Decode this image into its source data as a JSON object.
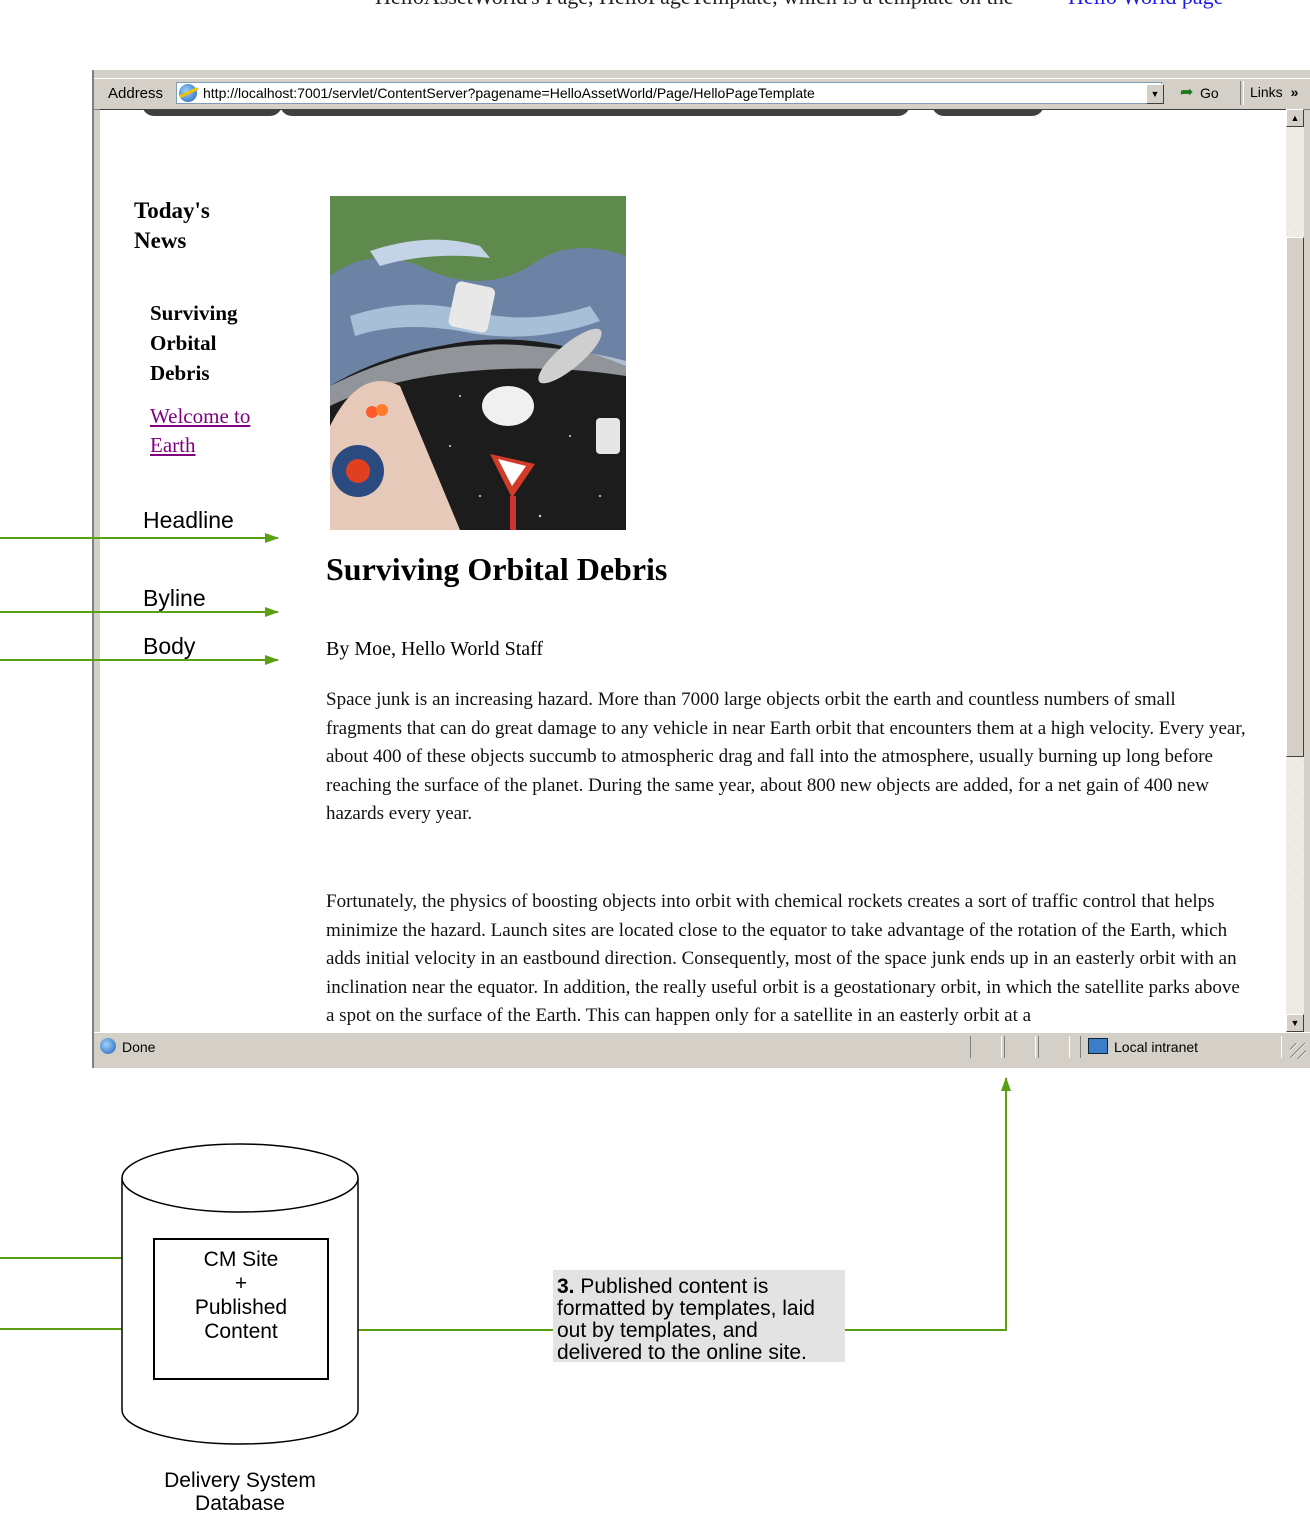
{
  "top_caption": {
    "left_text": "HelloAssetWorld's Page, HelloPageTemplate, which is a template on the",
    "right_link": "Hello World page"
  },
  "browser": {
    "address_label": "Address",
    "url": "http://localhost:7001/servlet/ContentServer?pagename=HelloAssetWorld/Page/HelloPageTemplate",
    "go_label": "Go",
    "links_label": "Links",
    "status_text": "Done",
    "zone_text": "Local intranet"
  },
  "page": {
    "sidebar_heading": "Today's News",
    "sidebar_current": "Surviving Orbital Debris",
    "sidebar_link": "Welcome to Earth",
    "headline": "Surviving Orbital Debris",
    "byline": "By Moe, Hello World Staff",
    "body_paragraphs": [
      "Space junk is an increasing hazard. More than 7000 large objects orbit the earth and countless numbers of small fragments that can do great damage to any vehicle in near Earth orbit that encounters them at a high velocity. Every year, about 400 of these objects succumb to atmospheric drag and fall into the atmosphere, usually burning up long before reaching the surface of the planet. During the same year, about 800 new objects are added, for a net gain of 400 new hazards every year.",
      "Fortunately, the physics of boosting objects into orbit with chemical rockets creates a sort of traffic control that helps minimize the hazard. Launch sites are located close to the equator to take advantage of the rotation of the Earth, which adds initial velocity in an eastbound direction. Consequently, most of the space junk ends up in an easterly orbit with an inclination near the equator. In addition, the really useful orbit is a geostationary orbit, in which the satellite parks above a spot on the surface of the Earth. This can happen only for a satellite in an easterly orbit at a"
    ]
  },
  "annotations": {
    "headline_label": "Headline",
    "byline_label": "Byline",
    "body_label": "Body",
    "db_box_lines": [
      "CM Site",
      "+",
      "Published",
      "Content"
    ],
    "db_caption_lines": [
      "Delivery System",
      "Database"
    ],
    "note_number": "3.",
    "note_text": "Published content is formatted by templates, laid out by templates, and delivered to the online site."
  },
  "colors": {
    "arrow_green": "#5aa012",
    "link_purple": "#800080",
    "note_bg": "#e3e3e3",
    "chrome_gray": "#d4d0c8"
  },
  "icons": [
    "ie-page-icon",
    "go-arrow-icon",
    "chevron-right-double-icon",
    "dropdown-arrow-icon",
    "scroll-up-arrow-icon",
    "scroll-down-arrow-icon",
    "local-intranet-icon",
    "resize-grip-icon"
  ]
}
